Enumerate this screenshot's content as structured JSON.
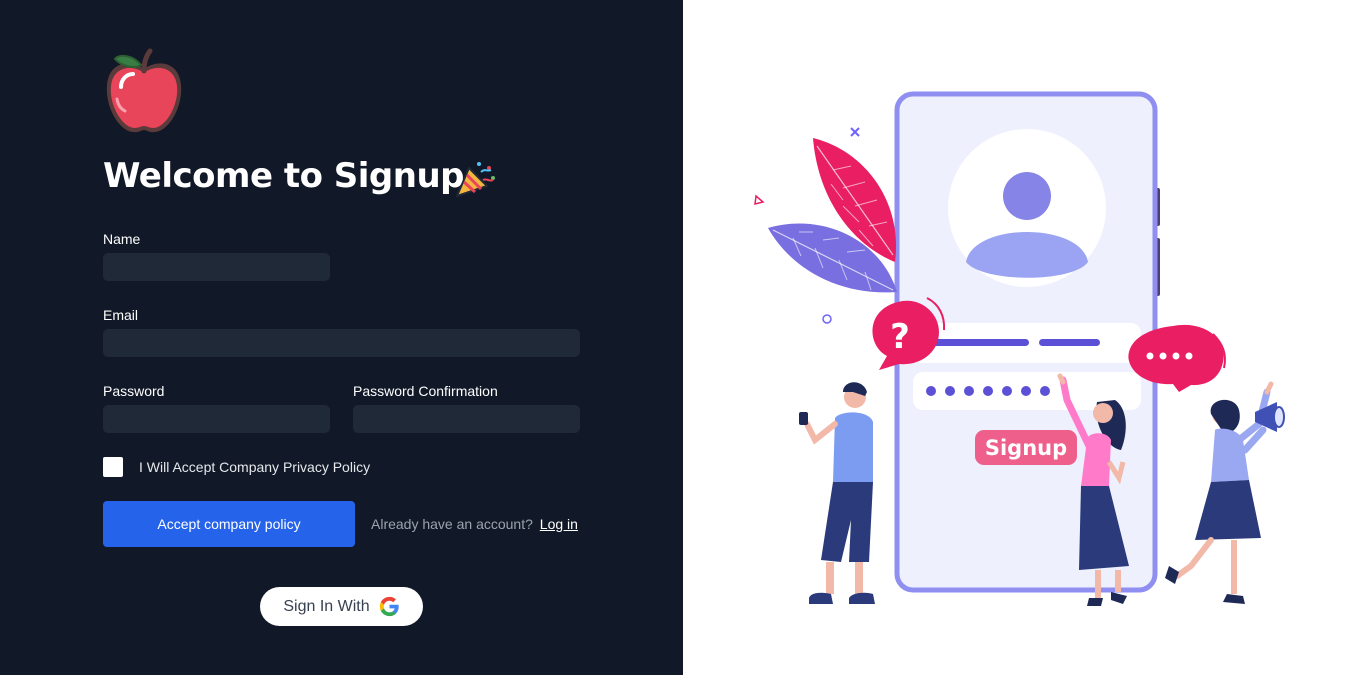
{
  "page": {
    "title": "Welcome to Signup",
    "logo_icon": "apple-icon",
    "title_icon": "party-popper-icon"
  },
  "form": {
    "name_label": "Name",
    "name_value": "",
    "email_label": "Email",
    "email_value": "",
    "password_label": "Password",
    "password_value": "",
    "password_confirmation_label": "Password Confirmation",
    "password_confirmation_value": "",
    "policy_checkbox_label": "I Will Accept Company Privacy Policy",
    "policy_checked": false,
    "submit_label": "Accept company policy"
  },
  "login": {
    "prompt": "Already have an account?",
    "link_label": "Log in"
  },
  "social": {
    "label": "Sign In With",
    "icon": "google-icon"
  },
  "illustration": {
    "button_label": "Signup",
    "question_mark": "?"
  },
  "colors": {
    "left_background": "#111827",
    "input_background": "#1f2937",
    "primary": "#2563eb",
    "accent_pink": "#e91e63",
    "accent_purple": "#6c63ff"
  }
}
